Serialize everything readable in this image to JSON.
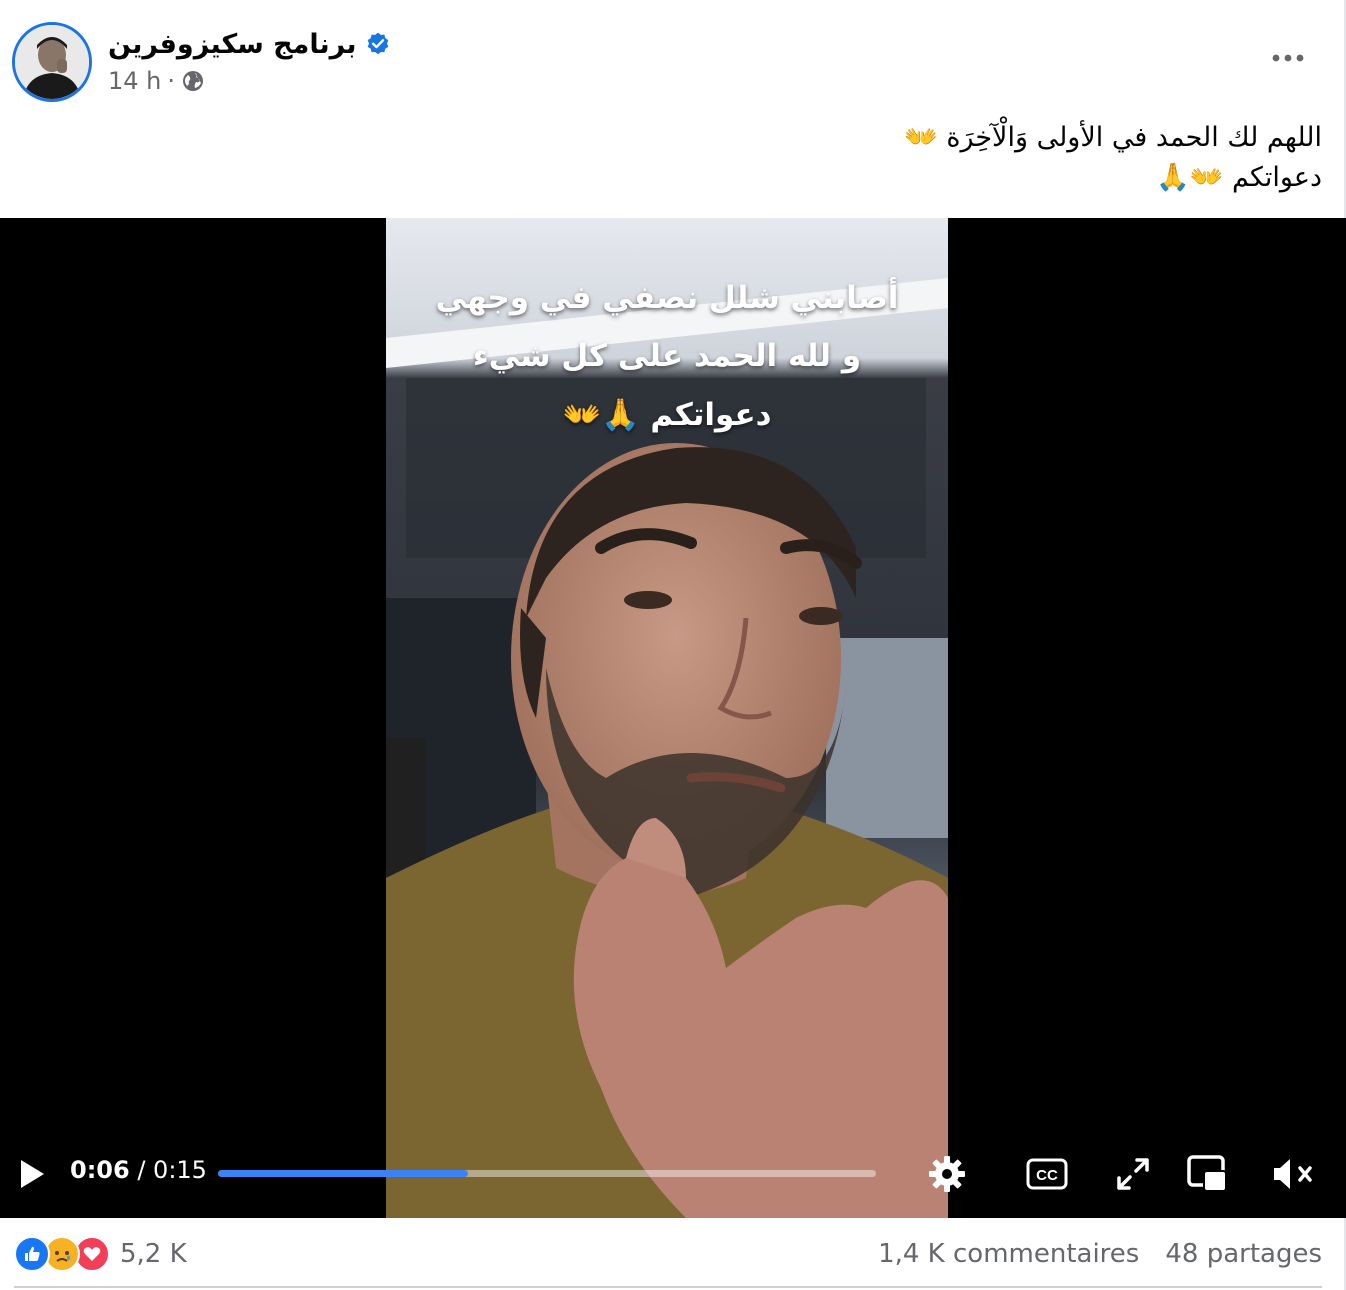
{
  "post": {
    "author": "برنامج سكيزوفرين",
    "verified": true,
    "time": "14 h",
    "separator": "·",
    "audience_icon": "globe-icon",
    "more_icon": "more-horizontal-icon",
    "caption_lines": [
      "اللهم لك الحمد في الأولى وَالْآخِرَة 👐",
      "دعواتكم 👐🙏"
    ]
  },
  "video": {
    "overlay_lines": [
      "أصابني شلل نصفي في وجهي",
      "و لله الحمد على كل شيء",
      "دعواتكم 🙏👐"
    ],
    "current_time": "0:06",
    "time_separator": " / ",
    "duration": "0:15",
    "progress": 0.38,
    "accent": "#3b82f6",
    "controls": [
      "play-icon",
      "settings-icon",
      "captions-icon",
      "fullscreen-icon",
      "picture-in-picture-icon",
      "mute-icon"
    ]
  },
  "footer": {
    "reaction_icons": [
      "like-icon",
      "sad-icon",
      "love-icon"
    ],
    "reaction_count": "5,2 K",
    "comments": "1,4 K commentaires",
    "shares": "48 partages"
  },
  "colors": {
    "link_blue": "#1b74e4",
    "secondary_text": "#65676b",
    "like": "#1877f2",
    "love": "#f33e58",
    "sad": "#f7b125"
  }
}
